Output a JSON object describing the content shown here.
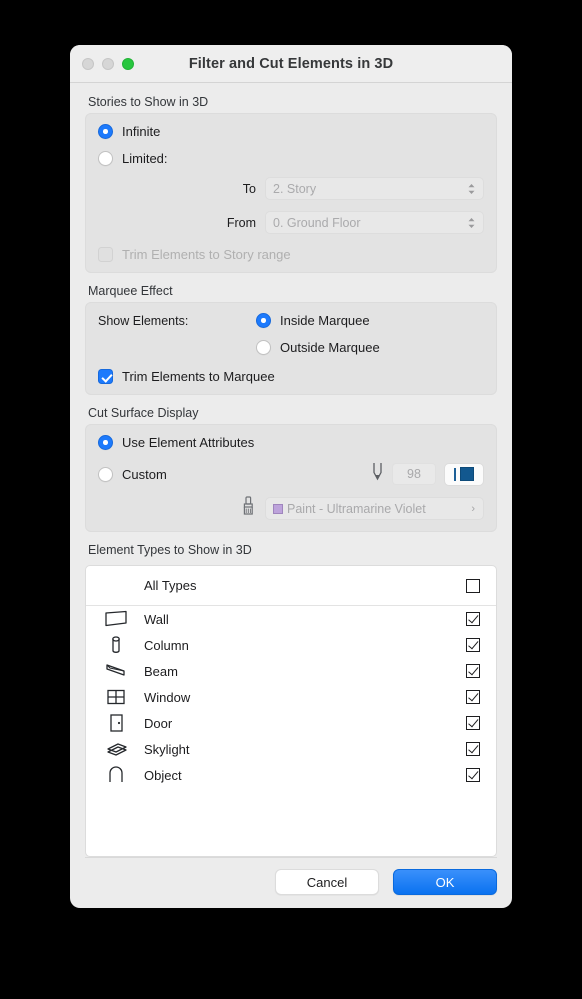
{
  "window": {
    "title": "Filter and Cut Elements in 3D",
    "traffic_lights": [
      "close",
      "minimize",
      "zoom"
    ]
  },
  "stories": {
    "section_label": "Stories to Show in 3D",
    "infinite_label": "Infinite",
    "infinite_selected": true,
    "limited_label": "Limited:",
    "limited_selected": false,
    "to_label": "To",
    "to_value": "2. Story",
    "from_label": "From",
    "from_value": "0. Ground Floor",
    "trim_label": "Trim Elements to Story range",
    "trim_checked": false
  },
  "marquee": {
    "section_label": "Marquee Effect",
    "show_elements_label": "Show Elements:",
    "inside_label": "Inside Marquee",
    "inside_selected": true,
    "outside_label": "Outside Marquee",
    "outside_selected": false,
    "trim_label": "Trim Elements to Marquee",
    "trim_checked": true
  },
  "cut_surface": {
    "section_label": "Cut Surface Display",
    "use_attributes_label": "Use Element Attributes",
    "use_attributes_selected": true,
    "custom_label": "Custom",
    "custom_selected": false,
    "pen_value": "98",
    "pen_color": "#12588f",
    "paint_value": "Paint - Ultramarine Violet",
    "paint_color": "#bda3db",
    "chevron": "›"
  },
  "element_types": {
    "section_label": "Element Types to Show in 3D",
    "all_types_label": "All Types",
    "all_types_checked": false,
    "rows": [
      {
        "label": "Wall",
        "icon": "wall-icon",
        "checked": true
      },
      {
        "label": "Column",
        "icon": "column-icon",
        "checked": true
      },
      {
        "label": "Beam",
        "icon": "beam-icon",
        "checked": true
      },
      {
        "label": "Window",
        "icon": "window-icon",
        "checked": true
      },
      {
        "label": "Door",
        "icon": "door-icon",
        "checked": true
      },
      {
        "label": "Skylight",
        "icon": "skylight-icon",
        "checked": true
      },
      {
        "label": "Object",
        "icon": "object-icon",
        "checked": true
      }
    ]
  },
  "footer": {
    "cancel_label": "Cancel",
    "ok_label": "OK"
  },
  "colors": {
    "accent": "#1d7afc",
    "ok_button": "#0a72f0",
    "zoom_light": "#28c63f"
  }
}
